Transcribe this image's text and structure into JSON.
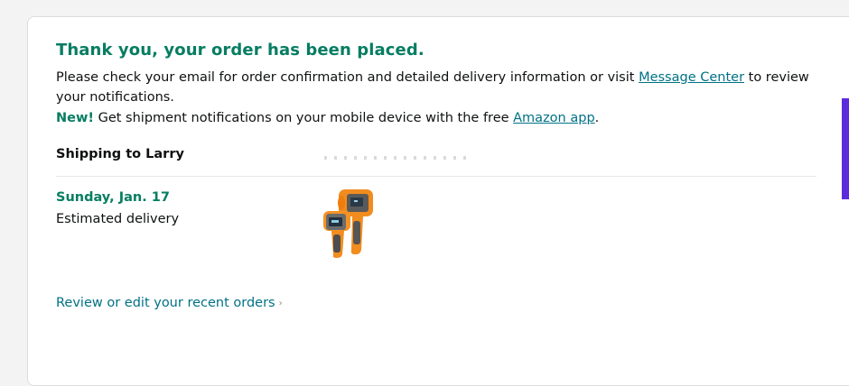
{
  "confirmation": {
    "title": "Thank you, your order has been placed.",
    "message_part1": "Please check your email for order confirmation and detailed delivery information or visit ",
    "message_center_link": "Message Center",
    "message_part2": " to review",
    "message_part3": "your notifications.",
    "new_label": "New!",
    "app_text": " Get shipment notifications on your mobile device with the free ",
    "app_link": "Amazon app",
    "app_period": "."
  },
  "shipping": {
    "label": "Shipping to Larry Z"
  },
  "delivery": {
    "date": "Sunday, Jan. 17",
    "estimate_label": "Estimated delivery"
  },
  "product": {
    "icon": "infrared-thermometer-image"
  },
  "footer": {
    "review_link": "Review or edit your recent orders",
    "review_chevron": "›"
  },
  "colors": {
    "success_green": "#067d62",
    "link_teal": "#007185",
    "text": "#0f1111",
    "accent": "#5b2bdc"
  }
}
